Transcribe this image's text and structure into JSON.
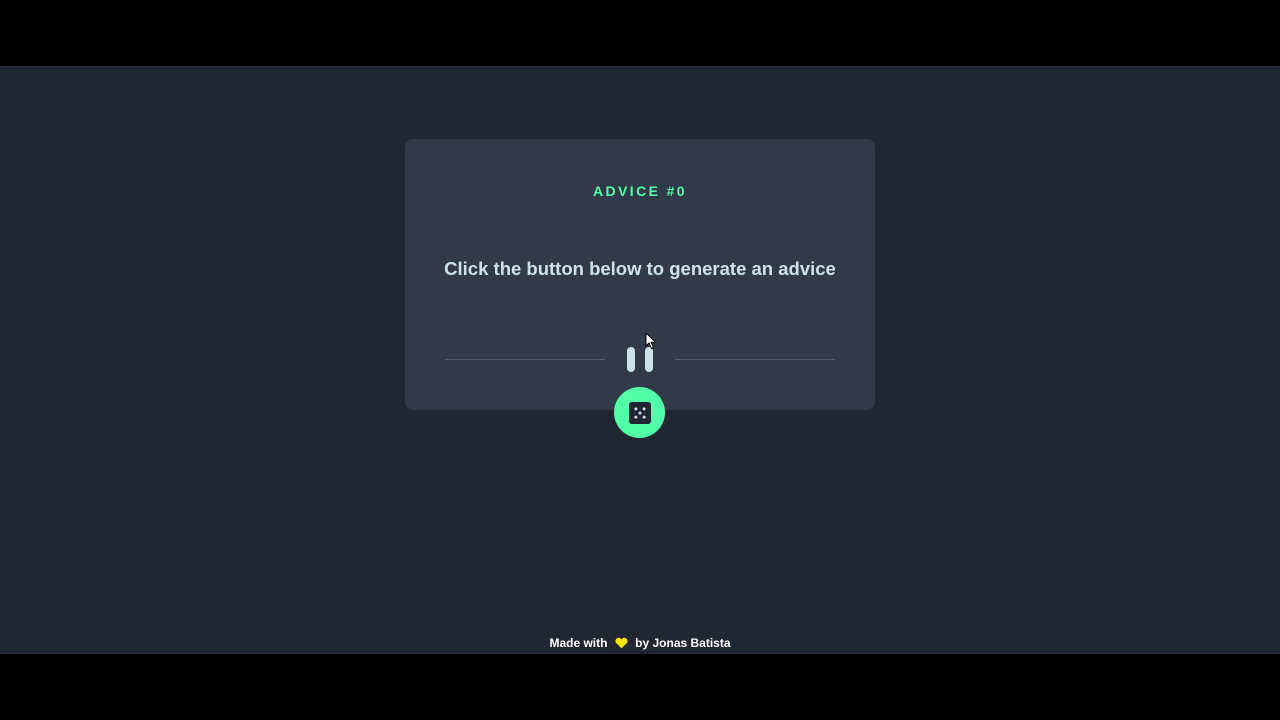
{
  "advice": {
    "id_label": "ADVICE #0",
    "text": "Click the button below to generate an advice"
  },
  "icons": {
    "divider": "pause-icon",
    "button": "dice-icon",
    "footer": "heart-icon",
    "cursor": "mouse-pointer-icon"
  },
  "footer": {
    "made_with": "Made with",
    "by": "by Jonas Batista"
  },
  "colors": {
    "background": "#202733",
    "card": "#313a48",
    "accent": "#52ffa8",
    "text": "#cee3e9",
    "divider": "#4f5d74",
    "heart": "#ffe600"
  }
}
